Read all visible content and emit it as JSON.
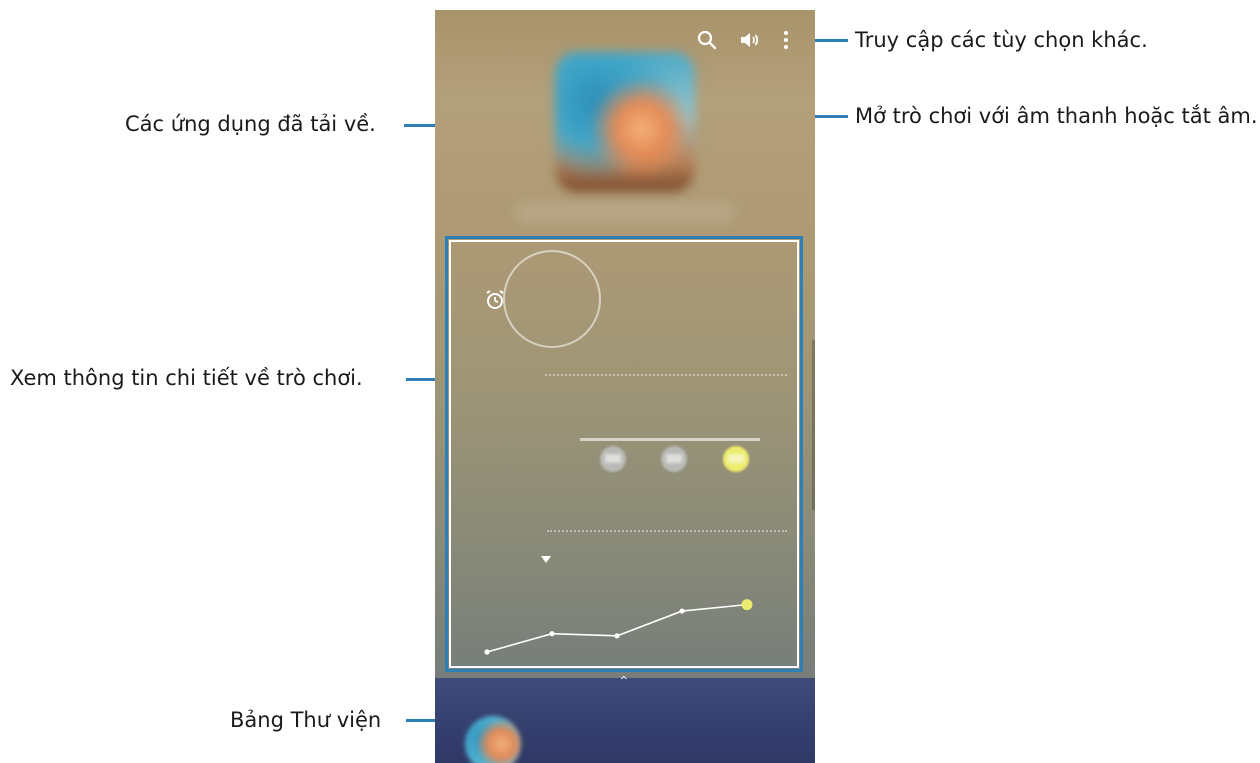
{
  "annotations": {
    "more_options": "Truy cập các tùy chọn khác.",
    "sound_toggle": "Mở trò chơi với âm thanh hoặc tắt âm.",
    "downloaded_apps": "Các ứng dụng đã tải về.",
    "game_details": "Xem thông tin chi tiết về trò chơi.",
    "library_panel": "Bảng Thư viện"
  },
  "toolbar": {
    "icons": [
      "search-icon",
      "volume-icon",
      "more-options-icon"
    ]
  },
  "details": {
    "chart_data": {
      "type": "line",
      "x": [
        1,
        2,
        3,
        4,
        5
      ],
      "series": [
        {
          "values": [
            33,
            50,
            48,
            71,
            77
          ]
        }
      ],
      "highlight_index": 4
    }
  },
  "colors": {
    "callout_line": "#2e7fb6",
    "library_panel": "#333c6c",
    "highlight": "#ecec6e"
  }
}
